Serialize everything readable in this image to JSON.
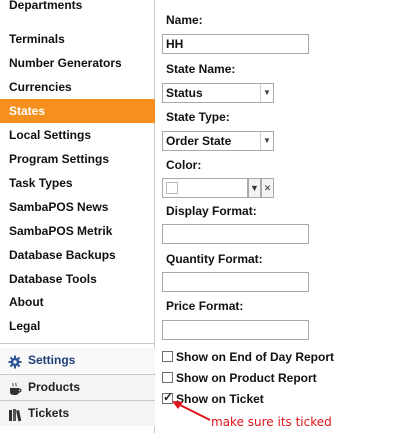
{
  "sidebar": {
    "items": [
      {
        "label": "Departments",
        "selected": false
      },
      {
        "label": "Terminals",
        "selected": false
      },
      {
        "label": "Number Generators",
        "selected": false
      },
      {
        "label": "Currencies",
        "selected": false
      },
      {
        "label": "States",
        "selected": true
      },
      {
        "label": "Local Settings",
        "selected": false
      },
      {
        "label": "Program Settings",
        "selected": false
      },
      {
        "label": "Task Types",
        "selected": false
      },
      {
        "label": "SambaPOS News",
        "selected": false
      },
      {
        "label": "SambaPOS Metrik",
        "selected": false
      },
      {
        "label": "Database Backups",
        "selected": false
      },
      {
        "label": "Database Tools",
        "selected": false
      },
      {
        "label": "About",
        "selected": false
      },
      {
        "label": "Legal",
        "selected": false
      }
    ],
    "sections": [
      {
        "label": "Settings",
        "icon": "gear-icon",
        "active": true
      },
      {
        "label": "Products",
        "icon": "coffee-cup-icon",
        "active": false
      },
      {
        "label": "Tickets",
        "icon": "books-icon",
        "active": false
      }
    ]
  },
  "form": {
    "name_label": "Name:",
    "name_value": "HH",
    "state_name_label": "State Name:",
    "state_name_value": "Status",
    "state_type_label": "State Type:",
    "state_type_value": "Order State",
    "color_label": "Color:",
    "display_format_label": "Display Format:",
    "display_format_value": "",
    "quantity_format_label": "Quantity Format:",
    "quantity_format_value": "",
    "price_format_label": "Price Format:",
    "price_format_value": "",
    "checkboxes": [
      {
        "label": "Show on End of Day Report",
        "checked": false
      },
      {
        "label": "Show on Product Report",
        "checked": false
      },
      {
        "label": "Show on Ticket",
        "checked": true
      }
    ]
  },
  "annotation": {
    "text": "make sure its ticked",
    "color": "#e0121b"
  },
  "colors": {
    "selected_bg": "#f5901e",
    "active_section": "#1f3f77"
  }
}
